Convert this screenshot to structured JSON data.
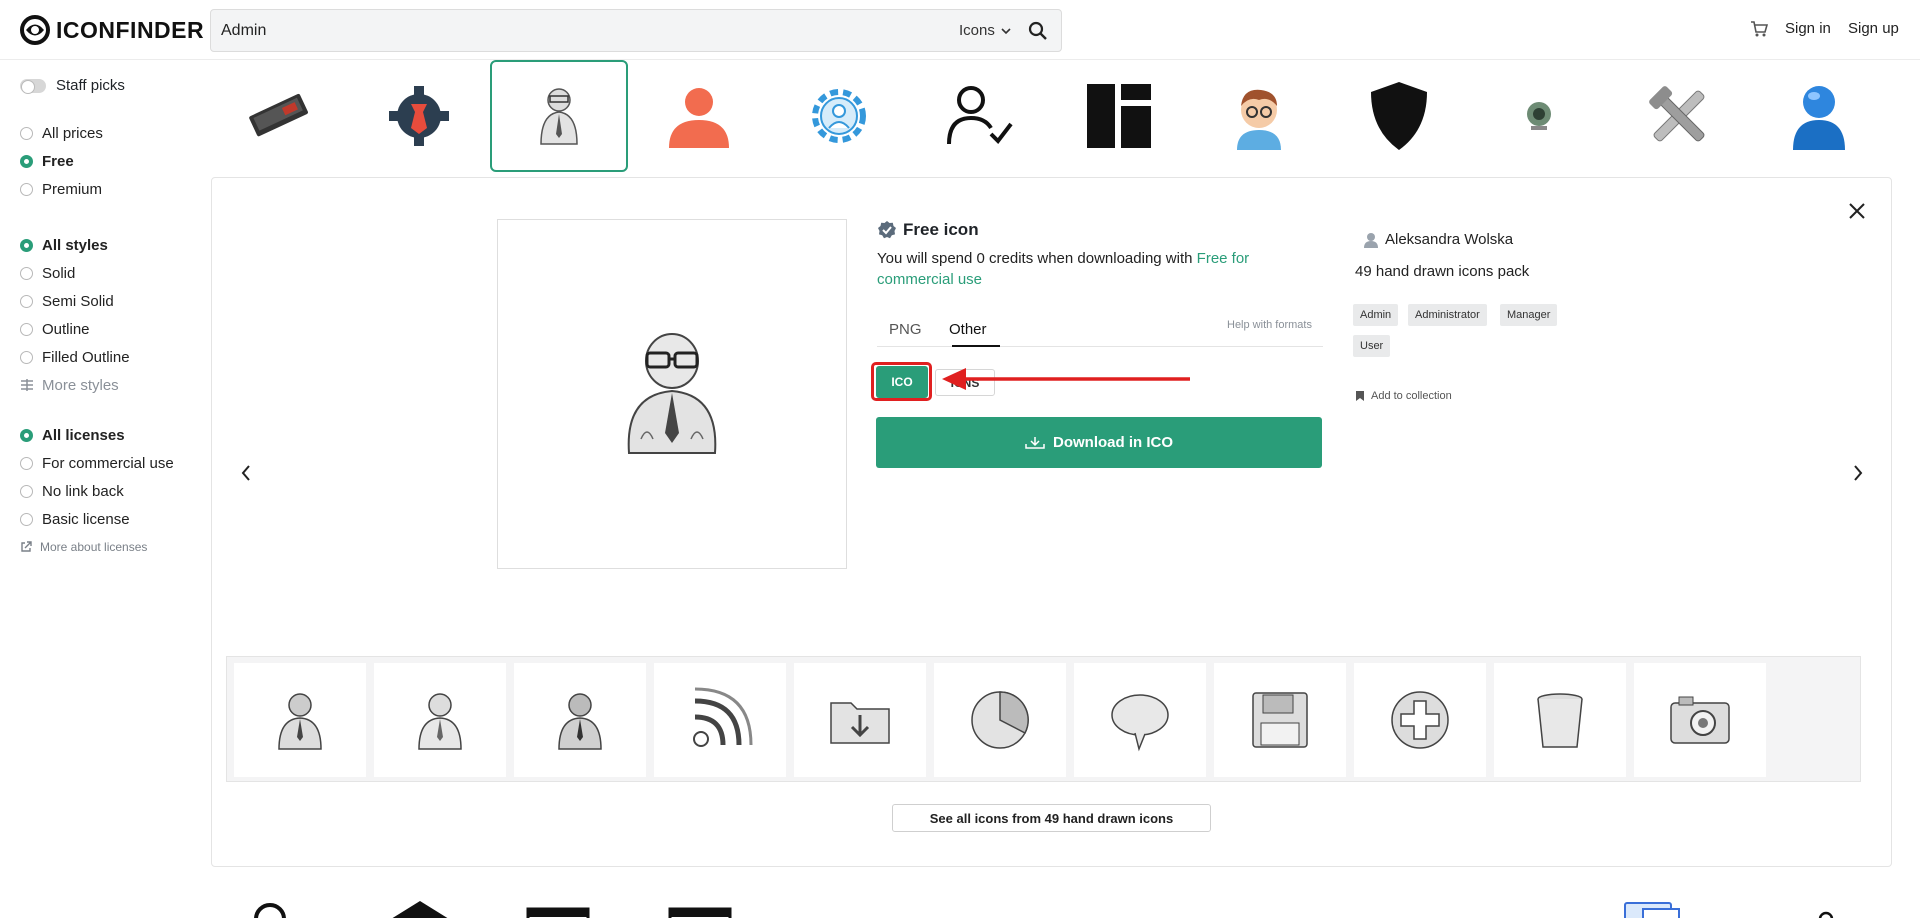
{
  "header": {
    "logo_text": "ICONFINDER",
    "search_value": "Admin",
    "search_type": "Icons",
    "sign_in": "Sign in",
    "sign_up": "Sign up"
  },
  "sidebar": {
    "staff_picks": "Staff picks",
    "prices": [
      {
        "label": "All prices",
        "selected": false
      },
      {
        "label": "Free",
        "selected": true
      },
      {
        "label": "Premium",
        "selected": false
      }
    ],
    "styles": [
      {
        "label": "All styles",
        "selected": true
      },
      {
        "label": "Solid",
        "selected": false
      },
      {
        "label": "Semi Solid",
        "selected": false
      },
      {
        "label": "Outline",
        "selected": false
      },
      {
        "label": "Filled Outline",
        "selected": false
      }
    ],
    "more_styles": "More styles",
    "licenses": [
      {
        "label": "All licenses",
        "selected": true
      },
      {
        "label": "For commercial use",
        "selected": false
      },
      {
        "label": "No link back",
        "selected": false
      },
      {
        "label": "Basic license",
        "selected": false
      }
    ],
    "more_licenses": "More about licenses"
  },
  "strip": {
    "icons": [
      "ssd-drive-icon",
      "gear-wrench-icon",
      "sketch-admin-icon",
      "person-silhouette-icon",
      "gear-person-icon",
      "user-check-icon",
      "dashboard-layout-icon",
      "nerd-avatar-icon",
      "shield-icon",
      "webcam-icon",
      "tools-icon",
      "blue-user-icon"
    ],
    "active_index": 2
  },
  "detail": {
    "free_title": "Free icon",
    "spend_text": "You will spend 0 credits when downloading with ",
    "spend_link": "Free for commercial use",
    "tab_png": "PNG",
    "tab_other": "Other",
    "help": "Help with formats",
    "format_ico": "ICO",
    "format_icns": "ICNS",
    "download": "Download in ICO",
    "author": "Aleksandra Wolska",
    "pack": "49 hand drawn icons pack",
    "tags": [
      "Admin",
      "Administrator",
      "Manager",
      "User"
    ],
    "add_collection": "Add to collection",
    "see_all": "See all icons from 49 hand drawn icons"
  },
  "thumbnails": [
    "user-icon",
    "user-icon",
    "user-icon",
    "rss-icon",
    "folder-download-icon",
    "pie-chart-icon",
    "speech-bubble-icon",
    "floppy-disk-icon",
    "plus-circle-icon",
    "trash-bin-icon",
    "camera-icon"
  ],
  "colors": {
    "accent": "#2a9d79",
    "highlight": "#e02020"
  }
}
